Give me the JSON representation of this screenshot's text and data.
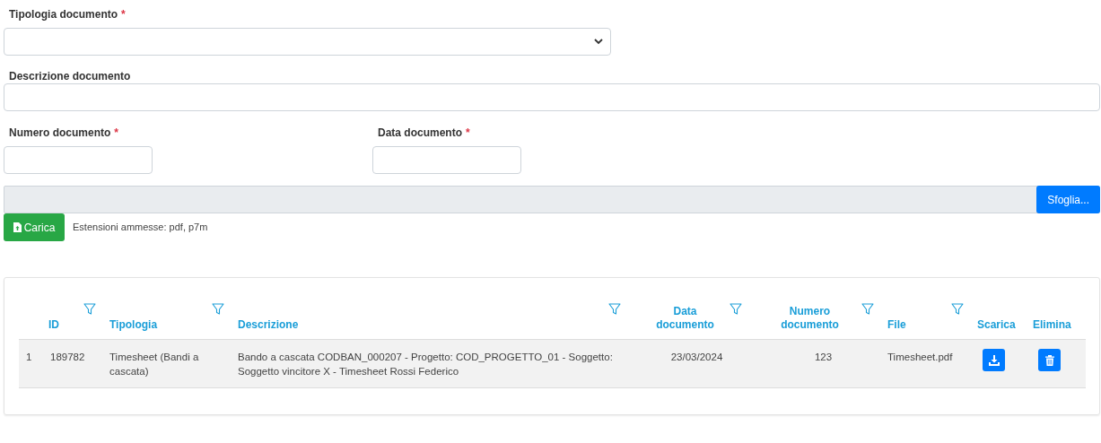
{
  "form": {
    "fields": [
      {
        "kind": "select",
        "label": "Tipologia documento",
        "required_mark": "*"
      },
      {
        "kind": "text",
        "label": "Descrizione documento"
      },
      {
        "kind": "text",
        "label": "Numero documento",
        "required_mark": "*"
      },
      {
        "kind": "text",
        "label": "Data documento",
        "required_mark": "*"
      }
    ],
    "file_input": {
      "button": "Sfoglia..."
    },
    "upload_button": "Carica",
    "extensions_note": "Estensioni ammesse: pdf, p7m"
  },
  "table": {
    "columns": [
      {
        "label": "ID",
        "filter": true
      },
      {
        "label": "Tipologia",
        "filter": true
      },
      {
        "label": "Descrizione",
        "filter": true
      },
      {
        "label": "Data documento",
        "filter": true
      },
      {
        "label": "Numero documento",
        "filter": true
      },
      {
        "label": "File",
        "filter": true
      },
      {
        "label": "Scarica",
        "filter": false
      },
      {
        "label": "Elimina",
        "filter": false
      }
    ],
    "rows": [
      {
        "number": "1",
        "cells": [
          "189782",
          "Timesheet (Bandi a cascata)",
          "Bando a cascata CODBAN_000207 - Progetto: COD_PROGETTO_01 - Soggetto: Soggetto vincitore X - Timesheet Rossi Federico",
          "23/03/2024",
          "123",
          "Timesheet.pdf"
        ],
        "actions": [
          {
            "kind": "download"
          },
          {
            "kind": "delete"
          }
        ]
      }
    ]
  }
}
